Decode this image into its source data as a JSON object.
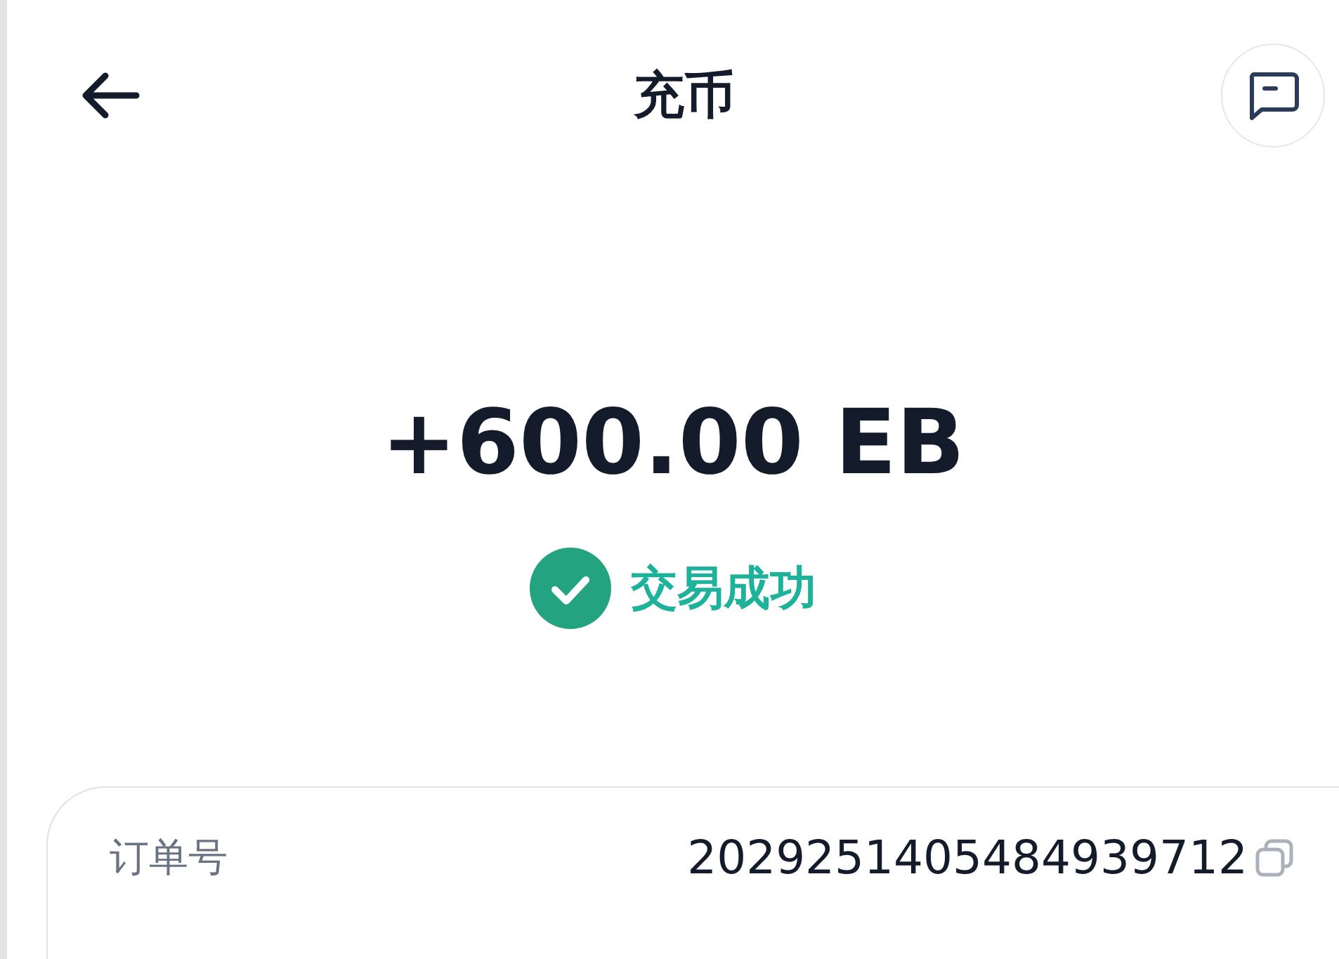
{
  "header": {
    "title": "充币"
  },
  "amount": "+600.00 EB",
  "status": {
    "text": "交易成功"
  },
  "details": [
    {
      "label": "订单号",
      "value": "2029251405484939712"
    }
  ]
}
